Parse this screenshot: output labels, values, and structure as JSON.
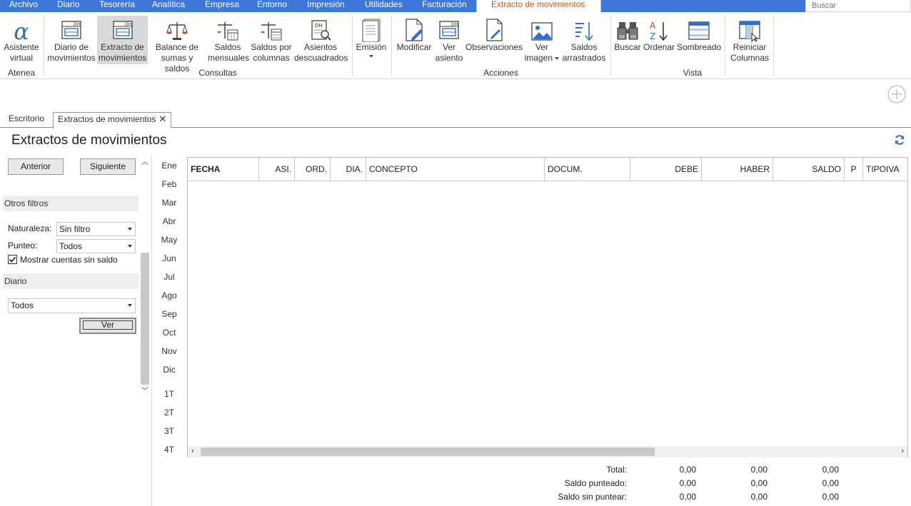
{
  "menu": {
    "tabs": [
      "Archivo",
      "Diario",
      "Tesorería",
      "Analítica",
      "Empresa",
      "Entorno",
      "Impresión",
      "Utilidades",
      "Facturación",
      "Extracto de movimientos"
    ],
    "search_placeholder": "Buscar"
  },
  "ribbon": {
    "buttons": [
      {
        "label": "Asistente\nvirtual",
        "icon": "alpha-icon"
      },
      {
        "label": "Diario de\nmovimientos",
        "icon": "ledger-icon"
      },
      {
        "label": "Extracto de\nmovimientos",
        "icon": "ledger-icon"
      },
      {
        "label": "Balance de\nsumas y saldos",
        "icon": "scale-icon"
      },
      {
        "label": "Saldos\nmensuales",
        "icon": "scale-calendar-icon"
      },
      {
        "label": "Saldos por\ncolumnas",
        "icon": "scale-columns-icon"
      },
      {
        "label": "Asientos\ndescuadrados",
        "icon": "ledger-search-icon"
      },
      {
        "label": "Emisión",
        "icon": "document-icon"
      },
      {
        "label": "Modificar",
        "icon": "edit-document-icon"
      },
      {
        "label": "Ver\nasiento",
        "icon": "ledger-icon"
      },
      {
        "label": "Observaciones",
        "icon": "note-icon"
      },
      {
        "label": "Ver\nimagen",
        "icon": "image-icon"
      },
      {
        "label": "Saldos\narrastrados",
        "icon": "sort-down-icon"
      },
      {
        "label": "Buscar",
        "icon": "binoculars-icon"
      },
      {
        "label": "Ordenar",
        "icon": "sort-az-icon"
      },
      {
        "label": "Sombreado",
        "icon": "shading-icon"
      },
      {
        "label": "Reiniciar\nColumnas",
        "icon": "reset-columns-icon"
      }
    ],
    "groups": [
      "Atenea",
      "Consultas",
      "Acciones",
      "Vista"
    ]
  },
  "doc_tabs": [
    "Escritorio",
    "Extractos de movimientos"
  ],
  "page_title": "Extractos de movimientos",
  "nav": {
    "prev": "Anterior",
    "next": "Siguiente"
  },
  "filters": {
    "header": "Otros filtros",
    "naturaleza_label": "Naturaleza:",
    "naturaleza_value": "Sin filtro",
    "punteo_label": "Punteo:",
    "punteo_value": "Todos",
    "show_zero_label": "Mostrar cuentas sin saldo",
    "show_zero_checked": true
  },
  "diario": {
    "header": "Diario",
    "value": "Todos",
    "ver_button": "Ver"
  },
  "periods": [
    "Ene",
    "Feb",
    "Mar",
    "Abr",
    "May",
    "Jun",
    "Jul",
    "Ago",
    "Sep",
    "Oct",
    "Nov",
    "Dic",
    "1T",
    "2T",
    "3T",
    "4T"
  ],
  "grid": {
    "columns": [
      "FECHA",
      "ASI.",
      "ORD.",
      "DIA.",
      "CONCEPTO",
      "DOCUM.",
      "DEBE",
      "HABER",
      "SALDO",
      "P",
      "TIPOIVA"
    ],
    "rows": []
  },
  "totals": [
    {
      "label": "Total:",
      "debe": "0,00",
      "haber": "0,00",
      "saldo": "0,00"
    },
    {
      "label": "Saldo punteado:",
      "debe": "0,00",
      "haber": "0,00",
      "saldo": "0,00"
    },
    {
      "label": "Saldo sin puntear:",
      "debe": "0,00",
      "haber": "0,00",
      "saldo": "0,00"
    }
  ],
  "colors": {
    "menu_bar": "#3d78d8",
    "active_tab_text": "#c55a11",
    "icon_blue": "#2e6fd0"
  }
}
